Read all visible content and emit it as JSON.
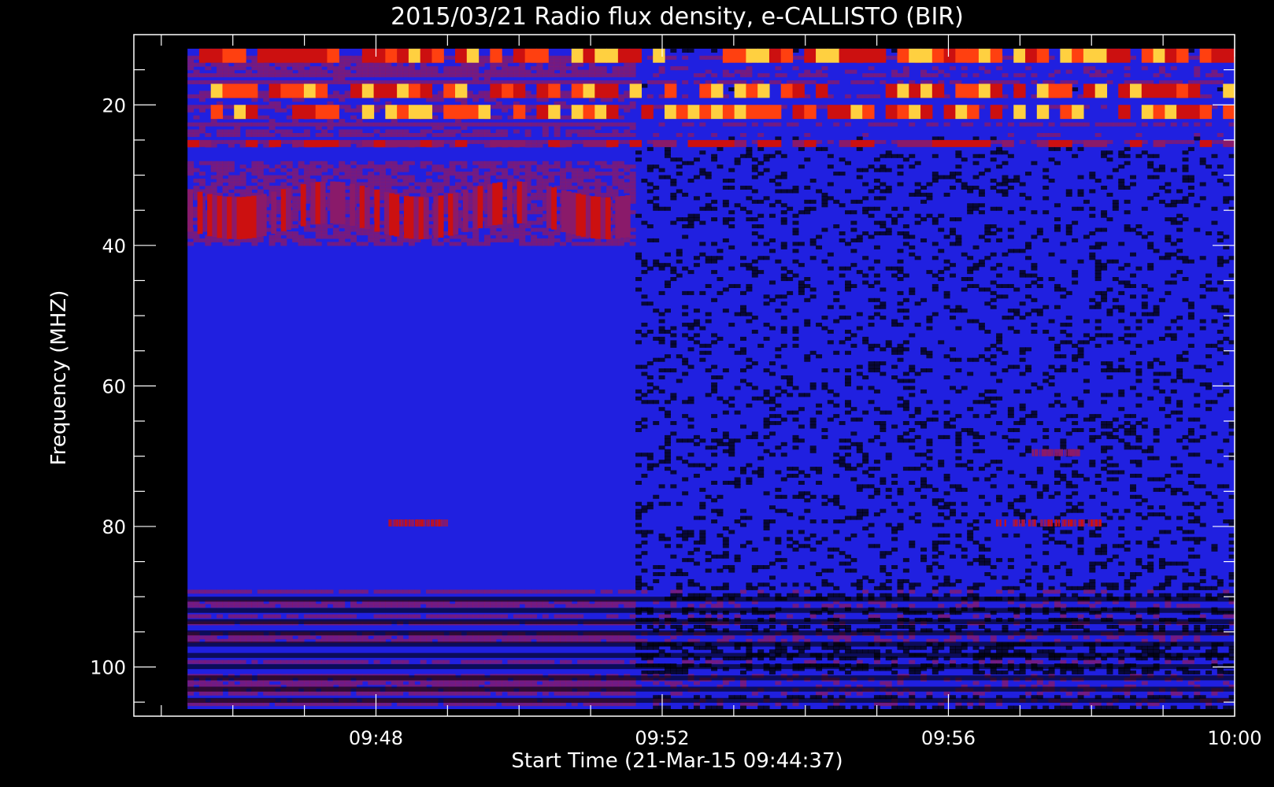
{
  "chart_data": {
    "type": "heatmap",
    "title": "2015/03/21  Radio flux density, e-CALLISTO (BIR)",
    "xlabel": "Start Time (21-Mar-15 09:44:37)",
    "ylabel": "Frequency (MHZ)",
    "xlim": [
      "09:44:37",
      "10:00:00"
    ],
    "ylim": [
      10,
      107
    ],
    "y_inverted": true,
    "x_ticks": [
      "09:48",
      "09:52",
      "09:56",
      "10:00"
    ],
    "y_ticks": [
      "20",
      "40",
      "60",
      "80",
      "100"
    ],
    "data_start": "09:45:22",
    "data_end": "10:00:00",
    "freq_range": [
      12,
      106
    ],
    "instrument_switch_time": "09:51:33",
    "colormap": [
      "#000000",
      "#2020e0",
      "#8a1a6a",
      "#cc1010",
      "#ff4010",
      "#ffd040"
    ],
    "features": [
      {
        "name": "RFI band",
        "freq_mhz": [
          12,
          14
        ],
        "intensity": "high"
      },
      {
        "name": "RFI band",
        "freq_mhz": [
          17,
          19
        ],
        "intensity": "high"
      },
      {
        "name": "RFI band",
        "freq_mhz": [
          20,
          22
        ],
        "intensity": "high"
      },
      {
        "name": "RFI band",
        "freq_mhz": [
          25,
          26
        ],
        "intensity": "medium"
      },
      {
        "name": "drifting emission",
        "freq_mhz": [
          32,
          38
        ],
        "time": [
          "09:45:22",
          "09:51:33"
        ],
        "intensity": "medium"
      },
      {
        "name": "narrow band",
        "freq_mhz": [
          79,
          80
        ],
        "time": [
          "09:48:10",
          "09:49:00"
        ],
        "intensity": "medium"
      },
      {
        "name": "narrow band",
        "freq_mhz": [
          79,
          80
        ],
        "time": [
          "09:56:40",
          "09:58:10"
        ],
        "intensity": "medium"
      },
      {
        "name": "narrow band",
        "freq_mhz": [
          69,
          70
        ],
        "time": [
          "09:57:10",
          "09:57:50"
        ],
        "intensity": "low"
      },
      {
        "name": "dark bands",
        "freq_mhz": [
          90,
          106
        ],
        "intensity": "low"
      }
    ]
  }
}
